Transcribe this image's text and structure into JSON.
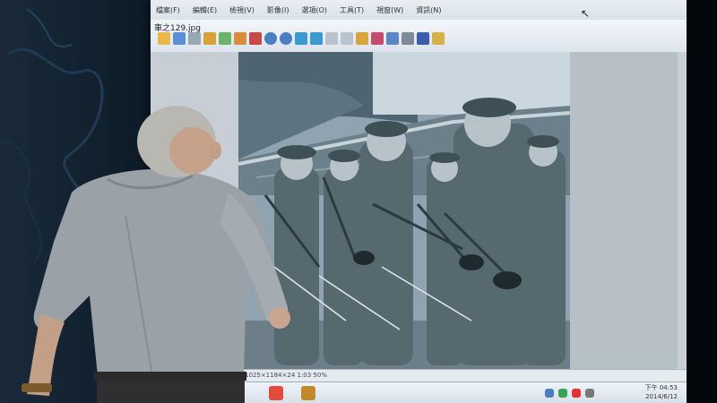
{
  "viewer": {
    "menu": [
      "檔案(F)",
      "編輯(E)",
      "檢視(V)",
      "影像(I)",
      "選項(O)",
      "工具(T)",
      "視窗(W)",
      "資訊(N)"
    ],
    "filename": "車之129.jpg",
    "status_text": "1025×1184×24 1:03  50%",
    "clock_time": "下午 04:53",
    "clock_date": "2014/6/12"
  },
  "colors": {
    "screen": "#c9d4dd",
    "photo_tone": "#6f8796",
    "shirt": "#9aa2a8"
  },
  "icons": [
    "open-icon",
    "save-icon",
    "crop-icon",
    "zoom-in-icon",
    "zoom-out-icon",
    "back-icon",
    "forward-icon",
    "print-icon",
    "settings-icon",
    "play-icon"
  ]
}
